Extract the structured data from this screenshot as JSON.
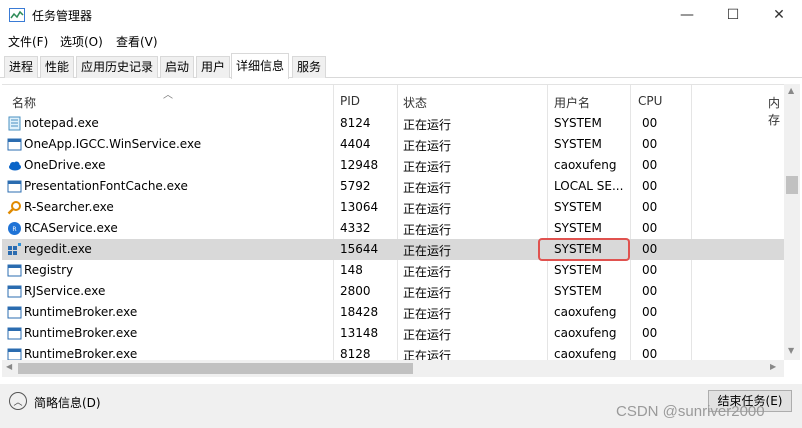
{
  "window": {
    "title": "任务管理器",
    "min_glyph": "—",
    "max_glyph": "☐",
    "close_glyph": "✕"
  },
  "menu": [
    "文件(F)",
    "选项(O)",
    "查看(V)"
  ],
  "tabs": [
    "进程",
    "性能",
    "应用历史记录",
    "启动",
    "用户",
    "详细信息",
    "服务"
  ],
  "active_tab": "详细信息",
  "columns": {
    "name": "名称",
    "pid": "PID",
    "status": "状态",
    "user": "用户名",
    "cpu": "CPU",
    "memory": "内存"
  },
  "rows": [
    {
      "name": "notepad.exe",
      "pid": "8124",
      "status": "正在运行",
      "user": "SYSTEM",
      "cpu": "00",
      "icon": "notepad-icon"
    },
    {
      "name": "OneApp.IGCC.WinService.exe",
      "pid": "4404",
      "status": "正在运行",
      "user": "SYSTEM",
      "cpu": "00",
      "icon": "generic-exe-icon"
    },
    {
      "name": "OneDrive.exe",
      "pid": "12948",
      "status": "正在运行",
      "user": "caoxufeng",
      "cpu": "00",
      "icon": "onedrive-cloud-icon"
    },
    {
      "name": "PresentationFontCache.exe",
      "pid": "5792",
      "status": "正在运行",
      "user": "LOCAL SE...",
      "cpu": "00",
      "icon": "generic-exe-icon"
    },
    {
      "name": "R-Searcher.exe",
      "pid": "13064",
      "status": "正在运行",
      "user": "SYSTEM",
      "cpu": "00",
      "icon": "magnifier-icon"
    },
    {
      "name": "RCAService.exe",
      "pid": "4332",
      "status": "正在运行",
      "user": "SYSTEM",
      "cpu": "00",
      "icon": "rca-service-icon"
    },
    {
      "name": "regedit.exe",
      "pid": "15644",
      "status": "正在运行",
      "user": "SYSTEM",
      "cpu": "00",
      "icon": "regedit-icon",
      "selected": true
    },
    {
      "name": "Registry",
      "pid": "148",
      "status": "正在运行",
      "user": "SYSTEM",
      "cpu": "00",
      "icon": "generic-exe-icon"
    },
    {
      "name": "RJService.exe",
      "pid": "2800",
      "status": "正在运行",
      "user": "SYSTEM",
      "cpu": "00",
      "icon": "generic-exe-icon"
    },
    {
      "name": "RuntimeBroker.exe",
      "pid": "18428",
      "status": "正在运行",
      "user": "caoxufeng",
      "cpu": "00",
      "icon": "generic-exe-icon"
    },
    {
      "name": "RuntimeBroker.exe",
      "pid": "13148",
      "status": "正在运行",
      "user": "caoxufeng",
      "cpu": "00",
      "icon": "generic-exe-icon"
    },
    {
      "name": "RuntimeBroker.exe",
      "pid": "8128",
      "status": "正在运行",
      "user": "caoxufeng",
      "cpu": "00",
      "icon": "generic-exe-icon"
    }
  ],
  "footer": {
    "collapse_label": "简略信息(D)",
    "end_task_label": "结束任务(E)"
  },
  "watermark": "CSDN @sunriver2000",
  "colors": {
    "selected_row": "#d9d9d9",
    "highlight_border": "#e0524f"
  }
}
